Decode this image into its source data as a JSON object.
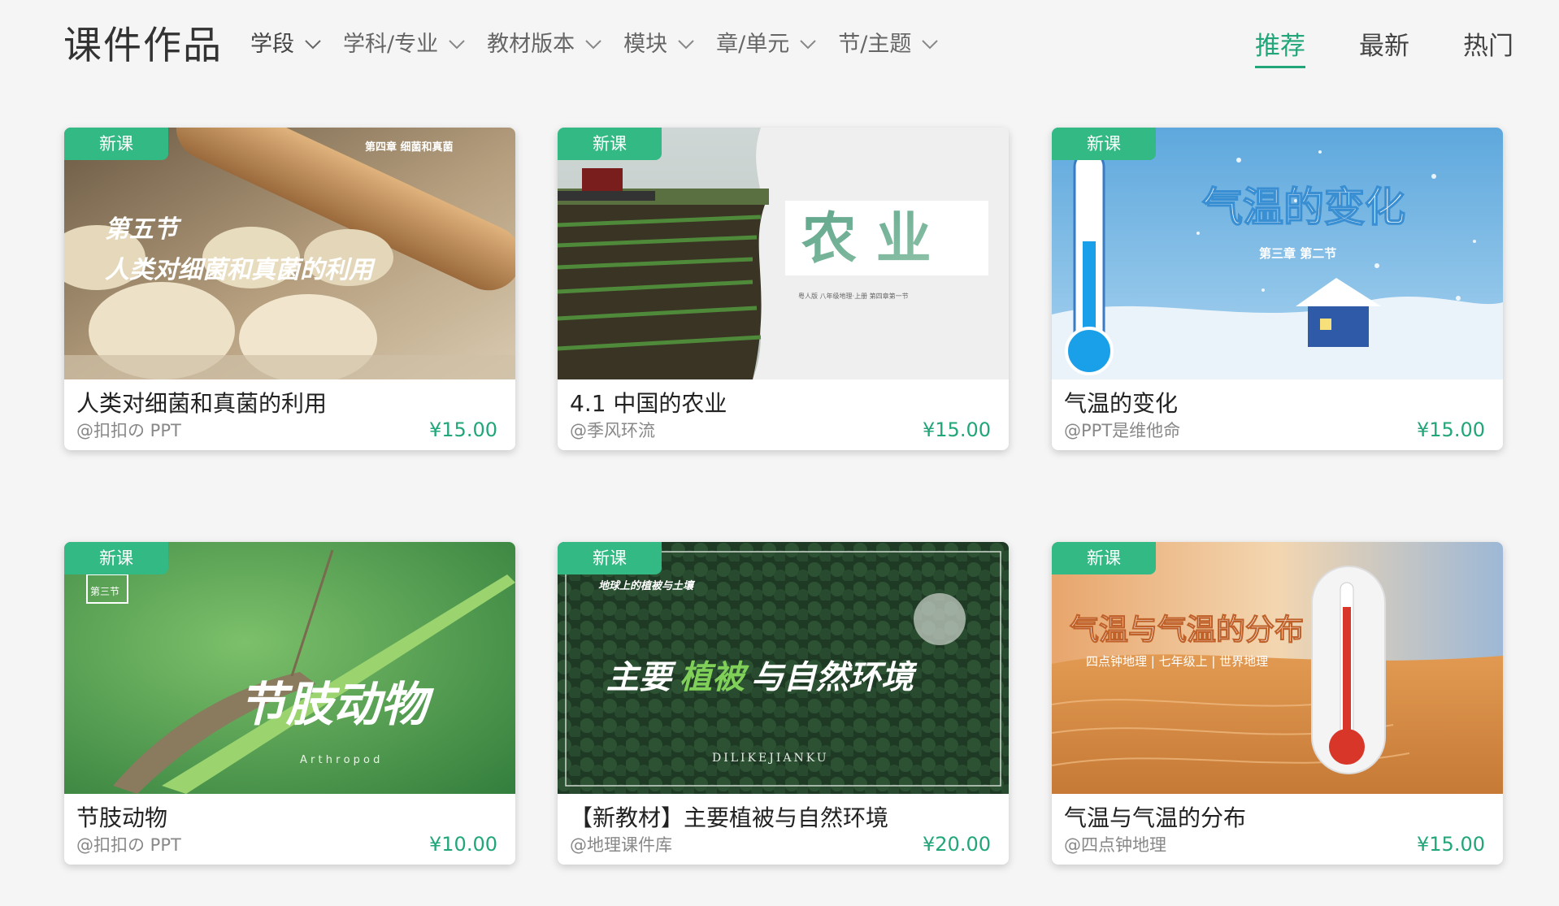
{
  "header": {
    "title": "课件作品",
    "filters": [
      "学段",
      "学科/专业",
      "教材版本",
      "模块",
      "章/单元",
      "节/主题"
    ],
    "sorts": [
      "推荐",
      "最新",
      "热门"
    ],
    "active_sort": "推荐",
    "accent_color": "#21a67a"
  },
  "cards": [
    {
      "badge": "新课",
      "title": "人类对细菌和真菌的利用",
      "author": "@扣扣の PPT",
      "price": "¥15.00",
      "thumb": {
        "lines": [
          "第四章 细菌和真菌",
          "第五节",
          "人类对细菌和真菌的利用"
        ]
      }
    },
    {
      "badge": "新课",
      "title": "4.1  中国的农业",
      "author": "@季风环流",
      "price": "¥15.00",
      "thumb": {
        "lines": [
          "农 业",
          "粤人版  八年级地理·上册     第四章第一节"
        ]
      }
    },
    {
      "badge": "新课",
      "title": "气温的变化",
      "author": "@PPT是维他命",
      "price": "¥15.00",
      "thumb": {
        "lines": [
          "气温的变化",
          "第三章   第二节"
        ]
      }
    },
    {
      "badge": "新课",
      "title": "节肢动物",
      "author": "@扣扣の PPT",
      "price": "¥10.00",
      "thumb": {
        "lines": [
          "第三节",
          "节肢动物",
          "A r t h r o p o d"
        ]
      }
    },
    {
      "badge": "新课",
      "title": "【新教材】主要植被与自然环境",
      "author": "@地理课件库",
      "price": "¥20.00",
      "thumb": {
        "lines": [
          "地球上的植被与土壤",
          "主要",
          "植被",
          "与自然环境",
          "DILIKEJIANKU"
        ]
      }
    },
    {
      "badge": "新课",
      "title": "气温与气温的分布",
      "author": "@四点钟地理",
      "price": "¥15.00",
      "thumb": {
        "lines": [
          "气温与气温的分布",
          "四点钟地理 | 七年级上 | 世界地理"
        ]
      }
    }
  ]
}
